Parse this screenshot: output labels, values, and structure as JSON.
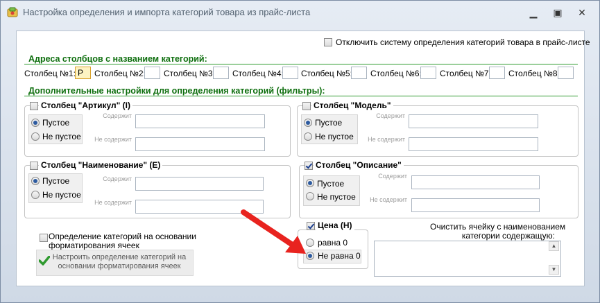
{
  "window": {
    "title": "Настройка определения и импорта категорий товара из прайс-листа",
    "icons": {
      "app": "app-box-icon",
      "minimize": "minimize-icon",
      "maximize": "maximize-icon",
      "close": "close-icon"
    },
    "glyphs": {
      "minimize": "▁",
      "maximize": "▣",
      "close": "✕"
    }
  },
  "disable_system": {
    "label": "Отключить систему определения категорий товара в прайс-листе",
    "checked": false
  },
  "columns_section": {
    "title": "Адреса столбцов с названием категорий:",
    "fields": [
      {
        "label": "Столбец №1:",
        "value": "P"
      },
      {
        "label": "Столбец №2:",
        "value": ""
      },
      {
        "label": "Столбец №3:",
        "value": ""
      },
      {
        "label": "Столбец №4:",
        "value": ""
      },
      {
        "label": "Столбец №5:",
        "value": ""
      },
      {
        "label": "Столбец №6:",
        "value": ""
      },
      {
        "label": "Столбец №7:",
        "value": ""
      },
      {
        "label": "Столбец №8:",
        "value": ""
      }
    ]
  },
  "filters_section": {
    "title": "Дополнительные настройки для определения категорий (фильтры):",
    "radio_empty": "Пустое",
    "radio_not_empty": "Не пустое",
    "contains_label": "Содержит",
    "not_contains_label": "Не содержит",
    "groups": [
      {
        "title": "Столбец \"Артикул\" (I)",
        "checked": false,
        "selected": "empty"
      },
      {
        "title": "Столбец \"Модель\"",
        "checked": false,
        "selected": "empty"
      },
      {
        "title": "Столбец \"Наименование\" (E)",
        "checked": false,
        "selected": "empty"
      },
      {
        "title": "Столбец \"Описание\"",
        "checked": true,
        "selected": "empty"
      }
    ]
  },
  "format_detect": {
    "label_line1": "Определение категорий на основании",
    "label_line2": "форматирования ячеек",
    "checked": false,
    "button_line1": "Настроить определение категорий на",
    "button_line2": "основании форматирования ячеек",
    "button_icon": "check-icon"
  },
  "price_group": {
    "title": "Цена (H)",
    "checked": true,
    "option_equal": "равна 0",
    "option_not_equal": "Не равна 0",
    "selected": "not_equal"
  },
  "clear_cell": {
    "label_line1": "Очистить ячейку с наименованием",
    "label_line2": "категории содержащую:",
    "value": "",
    "scroll_up_glyph": "▲",
    "scroll_down_glyph": "▼"
  },
  "colors": {
    "section_title": "#0d6e0d",
    "section_rule": "#2c9a2c",
    "arrow": "#e8231f"
  }
}
